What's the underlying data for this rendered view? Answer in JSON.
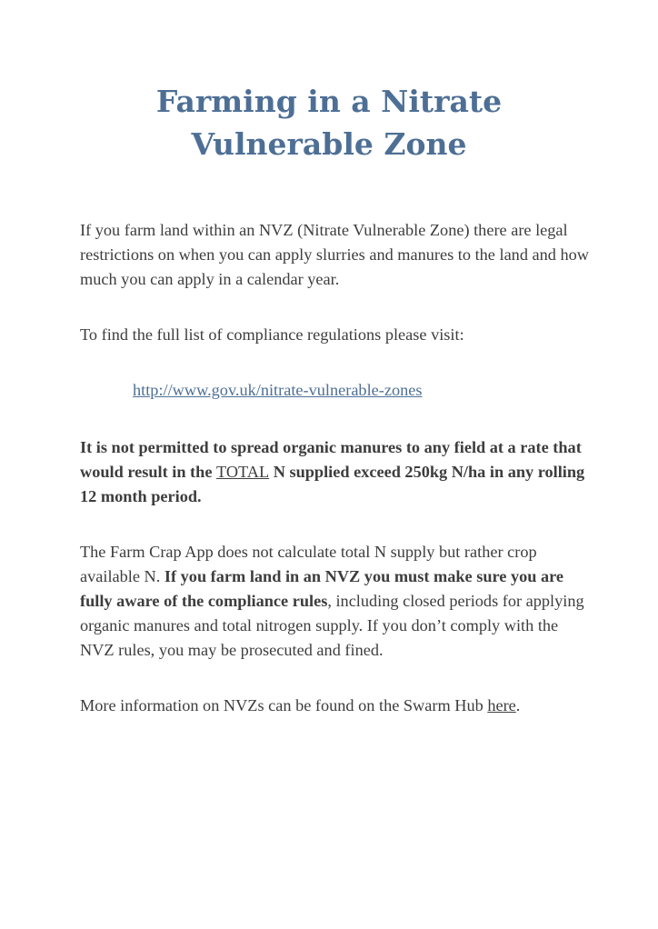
{
  "title": {
    "line1": "Farming in a Nitrate",
    "line2": "Vulnerable Zone"
  },
  "intro": "If you farm land within an NVZ (Nitrate Vulnerable Zone) there are legal restrictions on when you can apply slurries and manures to the land and how much you can apply in a calendar year.",
  "visit_text": "To find the full list of compliance regulations please visit:",
  "regulations_link": "http://www.gov.uk/nitrate-vulnerable-zones",
  "warning": {
    "part1": "It is not permitted to spread organic manures to any field at a rate that would result in the ",
    "emphasis": "TOTAL",
    "part2": " N supplied exceed 250kg N/ha in any rolling 12 month period."
  },
  "compliance": {
    "part1": "The Farm Crap App does not calculate total N supply but rather crop available N. ",
    "bold": "If you farm land in an NVZ you must make sure you are fully aware of the compliance rules",
    "part2": ", including closed periods for applying organic manures and total nitrogen supply. If you don’t comply with the NVZ rules, you may be prosecuted and fined."
  },
  "more_info": {
    "text": "More information on NVZs can be found on the Swarm Hub ",
    "link": "here",
    "end": "."
  }
}
